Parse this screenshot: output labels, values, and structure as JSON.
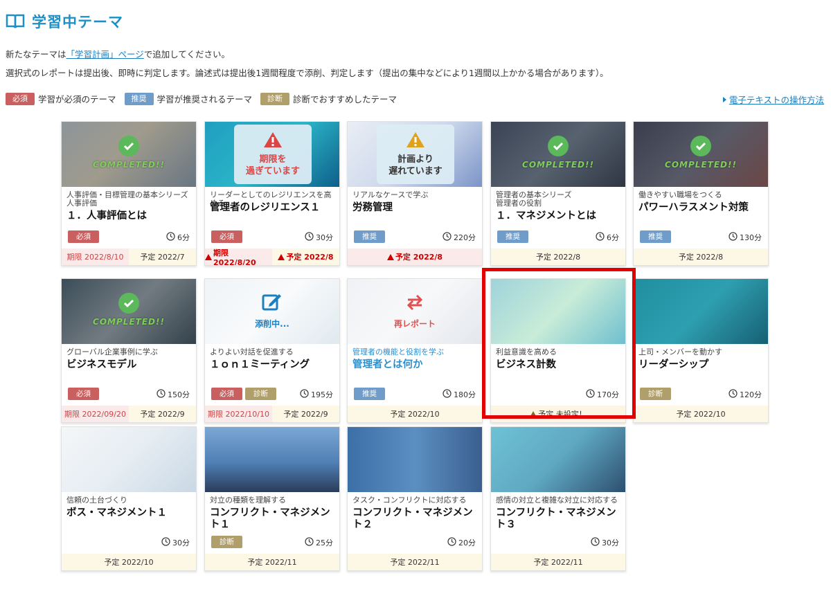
{
  "page": {
    "title": "学習中テーマ"
  },
  "intro": {
    "line1_pre": "新たなテーマは",
    "line1_link": "「学習計画」ページ",
    "line1_post": "で追加してください。",
    "line2": "選択式のレポートは提出後、即時に判定します。論述式は提出後1週間程度で添削、判定します（提出の集中などにより1週間以上かかる場合があります）。"
  },
  "legend": [
    {
      "badge": "必須",
      "text": "学習が必須のテーマ"
    },
    {
      "badge": "推奨",
      "text": "学習が推奨されるテーマ"
    },
    {
      "badge": "診断",
      "text": "診断でおすすめしたテーマ"
    }
  ],
  "manual_link": "電子テキストの操作方法",
  "status_text": {
    "completed": "COMPLETED!!",
    "overdue_line1": "期限を",
    "overdue_line2": "過ぎています",
    "late_line1": "計画より",
    "late_line2": "遅れています",
    "grading": "添削中...",
    "resubmit": "再レポート"
  },
  "colors": {
    "accent": "#1c8fc7",
    "required": "#c95f5f",
    "recommended": "#6f9cc9",
    "diagnosis": "#b09f6b",
    "highlight": "#e10000"
  },
  "cards": [
    {
      "subtitle": "人事評価・目標管理の基本シリーズ\n人事評価",
      "title": "１．人事評価とは",
      "badges": [
        "必須"
      ],
      "duration": "6分",
      "footer": [
        "期限 2022/8/10",
        "予定 2022/7"
      ],
      "status": "completed"
    },
    {
      "subtitle": "リーダーとしてのレジリエンスを高める",
      "title": "管理者のレジリエンス１",
      "badges": [
        "必須"
      ],
      "duration": "30分",
      "footer": [
        "期限 2022/8/20",
        "予定 2022/8"
      ],
      "status": "overdue"
    },
    {
      "subtitle": "リアルなケースで学ぶ",
      "title": "労務管理",
      "badges": [
        "推奨"
      ],
      "duration": "220分",
      "footer": [
        "予定 2022/8"
      ],
      "status": "late"
    },
    {
      "subtitle": "管理者の基本シリーズ\n管理者の役割",
      "title": "１．マネジメントとは",
      "badges": [
        "推奨"
      ],
      "duration": "6分",
      "footer": [
        "予定 2022/8"
      ],
      "status": "completed"
    },
    {
      "subtitle": "働きやすい職場をつくる",
      "title": "パワーハラスメント対策",
      "badges": [
        "推奨"
      ],
      "duration": "130分",
      "footer": [
        "予定 2022/8"
      ],
      "status": "completed"
    },
    {
      "subtitle": "グローバル企業事例に学ぶ",
      "title": "ビジネスモデル",
      "badges": [
        "必須"
      ],
      "duration": "150分",
      "footer": [
        "期限 2022/09/20",
        "予定 2022/9"
      ],
      "status": "completed"
    },
    {
      "subtitle": "よりよい対話を促進する",
      "title": "１ｏｎ１ミーティング",
      "badges": [
        "必須",
        "診断"
      ],
      "duration": "195分",
      "footer": [
        "期限 2022/10/10",
        "予定 2022/9"
      ],
      "status": "grading"
    },
    {
      "subtitle": "管理者の機能と役割を学ぶ",
      "title": "管理者とは何か",
      "badges": [
        "推奨"
      ],
      "duration": "180分",
      "footer": [
        "予定 2022/10"
      ],
      "status": "resubmit"
    },
    {
      "subtitle": "利益意識を高める",
      "title": "ビジネス計数",
      "badges": [],
      "duration": "170分",
      "footer": [
        "予定 未設定！"
      ],
      "status": "none"
    },
    {
      "subtitle": "上司・メンバーを動かす",
      "title": "リーダーシップ",
      "badges": [
        "診断"
      ],
      "duration": "120分",
      "footer": [
        "予定 2022/10"
      ],
      "status": "none"
    },
    {
      "subtitle": "信頼の土台づくり",
      "title": "ボス・マネジメント１",
      "badges": [],
      "duration": "30分",
      "footer": [
        "予定 2022/10"
      ],
      "status": "none"
    },
    {
      "subtitle": "対立の種類を理解する",
      "title": "コンフリクト・マネジメント１",
      "badges": [
        "診断"
      ],
      "duration": "25分",
      "footer": [
        "予定 2022/11"
      ],
      "status": "none"
    },
    {
      "subtitle": "タスク・コンフリクトに対応する",
      "title": "コンフリクト・マネジメント２",
      "badges": [],
      "duration": "20分",
      "footer": [
        "予定 2022/11"
      ],
      "status": "none"
    },
    {
      "subtitle": "感情の対立と複雑な対立に対応する",
      "title": "コンフリクト・マネジメント３",
      "badges": [],
      "duration": "30分",
      "footer": [
        "予定 2022/11"
      ],
      "status": "none"
    }
  ]
}
